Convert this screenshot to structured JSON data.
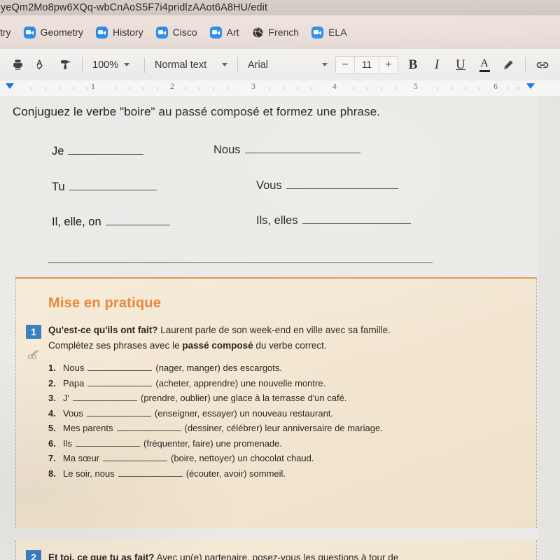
{
  "browser": {
    "url": "yeQm2Mo8pw6XQq-wbCnAoS5F7i4pridlzAAot6A8HU/edit",
    "bookmarks": [
      {
        "label": "try",
        "icon": "zoom-icon"
      },
      {
        "label": "Geometry",
        "icon": "zoom-icon"
      },
      {
        "label": "History",
        "icon": "zoom-icon"
      },
      {
        "label": "Cisco",
        "icon": "zoom-icon"
      },
      {
        "label": "Art",
        "icon": "zoom-icon"
      },
      {
        "label": "French",
        "icon": "globe-icon"
      },
      {
        "label": "ELA",
        "icon": "zoom-icon"
      }
    ]
  },
  "toolbar": {
    "print_icon": "print-icon",
    "spellcheck_icon": "spellcheck-icon",
    "paint_format_icon": "paint-format-icon",
    "zoom_level": "100%",
    "paragraph_style": "Normal text",
    "font_family": "Arial",
    "font_size": "11",
    "decrease_font_label": "−",
    "increase_font_label": "+",
    "bold_label": "B",
    "italic_label": "I",
    "underline_label": "U",
    "text_color_label": "A",
    "highlight_icon": "highlight-pen-icon",
    "link_icon": "link-icon"
  },
  "ruler": {
    "numbers": [
      "1",
      "2",
      "3",
      "4",
      "5",
      "6"
    ]
  },
  "document": {
    "prompt": "Conjuguez le verbe \"boire\" au passé composé et formez une phrase.",
    "conjugations": [
      {
        "left": "Je",
        "right": "Nous"
      },
      {
        "left": "Tu",
        "right": "Vous"
      },
      {
        "left": "Il, elle, on",
        "right": "Ils, elles"
      }
    ]
  },
  "worksheet": {
    "title": "Mise en pratique",
    "number_badge": "1",
    "scissors_icon": "scissors-icon",
    "intro_bold": "Qu'est-ce qu'ils ont fait?",
    "intro_rest": "Laurent parle de son week-end en ville avec sa famille.",
    "intro2_prefix": "Complétez ses phrases avec le ",
    "intro2_bold": "passé composé",
    "intro2_suffix": " du verbe correct.",
    "items": [
      {
        "num": "1.",
        "subject": "Nous",
        "rest": "(nager, manger) des escargots."
      },
      {
        "num": "2.",
        "subject": "Papa",
        "rest": "(acheter, apprendre) une nouvelle montre."
      },
      {
        "num": "3.",
        "subject": "J'",
        "rest": "(prendre, oublier) une glace à la terrasse d'un café."
      },
      {
        "num": "4.",
        "subject": "Vous",
        "rest": "(enseigner, essayer) un nouveau restaurant."
      },
      {
        "num": "5.",
        "subject": "Mes parents",
        "rest": "(dessiner, célébrer) leur anniversaire de mariage."
      },
      {
        "num": "6.",
        "subject": "Ils",
        "rest": "(fréquenter, faire) une promenade."
      },
      {
        "num": "7.",
        "subject": "Ma sœur",
        "rest": "(boire, nettoyer) un chocolat chaud."
      },
      {
        "num": "8.",
        "subject": "Le soir, nous",
        "rest": "(écouter, avoir) sommeil."
      }
    ]
  },
  "worksheet2": {
    "number_badge": "2",
    "bold": "Et toi, ce que tu as fait?",
    "rest": "Avec un(e) partenaire, posez-vous les questions à tour de"
  },
  "colors": {
    "accent_orange": "#e8883a",
    "badge_blue": "#3c7ec4",
    "bookmark_blue": "#2b8cf0",
    "indent_blue": "#1a73e8",
    "worksheet_bg": "#f3e7d2"
  }
}
